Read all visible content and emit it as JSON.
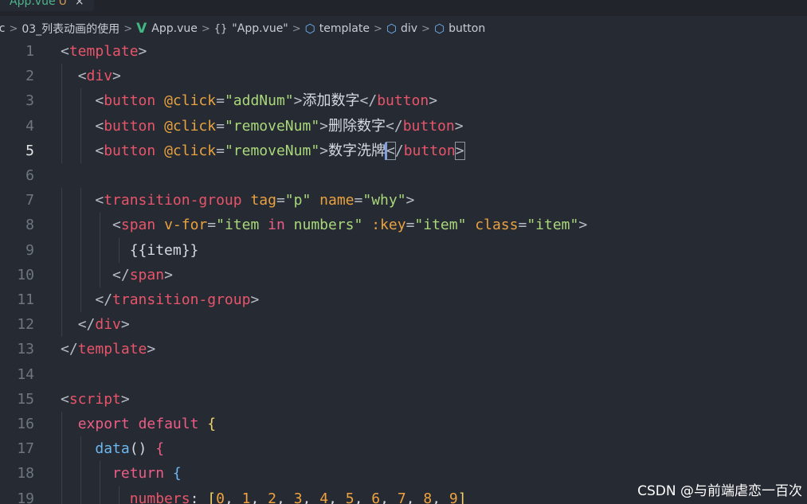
{
  "tab": {
    "filename": "App.vue",
    "modified_mark": "U",
    "close_glyph": "×"
  },
  "breadcrumb": {
    "items": [
      "src",
      "03_列表动画的使用",
      "App.vue",
      "\"App.vue\"",
      "template",
      "div",
      "button"
    ],
    "separator": ">",
    "braces_glyph": "{}",
    "vue_glyph": "V",
    "cube_glyph": "⬡"
  },
  "editor": {
    "active_line": "5",
    "lines": [
      {
        "n": "1",
        "tokens": [
          [
            "<",
            "br"
          ],
          [
            "template",
            "tag"
          ],
          [
            ">",
            "br"
          ]
        ]
      },
      {
        "n": "2",
        "tokens": [
          [
            "  ",
            "pl"
          ],
          [
            "<",
            "br"
          ],
          [
            "div",
            "tag"
          ],
          [
            ">",
            "br"
          ]
        ]
      },
      {
        "n": "3",
        "tokens": [
          [
            "    ",
            "pl"
          ],
          [
            "<",
            "br"
          ],
          [
            "button",
            "tag"
          ],
          [
            " ",
            "pl"
          ],
          [
            "@click",
            "attr"
          ],
          [
            "=",
            "eq"
          ],
          [
            "\"addNum\"",
            "str"
          ],
          [
            ">",
            "br"
          ],
          [
            "添加数字",
            "txt"
          ],
          [
            "</",
            "br"
          ],
          [
            "button",
            "tag"
          ],
          [
            ">",
            "br"
          ]
        ]
      },
      {
        "n": "4",
        "tokens": [
          [
            "    ",
            "pl"
          ],
          [
            "<",
            "br"
          ],
          [
            "button",
            "tag"
          ],
          [
            " ",
            "pl"
          ],
          [
            "@click",
            "attr"
          ],
          [
            "=",
            "eq"
          ],
          [
            "\"removeNum\"",
            "str"
          ],
          [
            ">",
            "br"
          ],
          [
            "删除数字",
            "txt"
          ],
          [
            "</",
            "br"
          ],
          [
            "button",
            "tag"
          ],
          [
            ">",
            "br"
          ]
        ]
      },
      {
        "n": "5",
        "tokens": [
          [
            "    ",
            "pl"
          ],
          [
            "<",
            "br"
          ],
          [
            "button",
            "tag"
          ],
          [
            " ",
            "pl"
          ],
          [
            "@click",
            "attr"
          ],
          [
            "=",
            "eq"
          ],
          [
            "\"removeNum\"",
            "str"
          ],
          [
            ">",
            "br"
          ],
          [
            "数字洗牌",
            "txt"
          ],
          [
            "<",
            "brbox"
          ],
          [
            "/",
            "br"
          ],
          [
            "button",
            "tag"
          ],
          [
            ">",
            "brbox"
          ]
        ]
      },
      {
        "n": "6",
        "tokens": []
      },
      {
        "n": "7",
        "tokens": [
          [
            "    ",
            "pl"
          ],
          [
            "<",
            "br"
          ],
          [
            "transition-group",
            "tag"
          ],
          [
            " ",
            "pl"
          ],
          [
            "tag",
            "attr"
          ],
          [
            "=",
            "eq"
          ],
          [
            "\"p\"",
            "str"
          ],
          [
            " ",
            "pl"
          ],
          [
            "name",
            "attr"
          ],
          [
            "=",
            "eq"
          ],
          [
            "\"why\"",
            "str"
          ],
          [
            ">",
            "br"
          ]
        ]
      },
      {
        "n": "8",
        "tokens": [
          [
            "      ",
            "pl"
          ],
          [
            "<",
            "br"
          ],
          [
            "span",
            "tag"
          ],
          [
            " ",
            "pl"
          ],
          [
            "v-for",
            "attr"
          ],
          [
            "=",
            "eq"
          ],
          [
            "\"item ",
            "str"
          ],
          [
            "in",
            "kw"
          ],
          [
            " numbers\"",
            "str"
          ],
          [
            " ",
            "pl"
          ],
          [
            ":key",
            "attr"
          ],
          [
            "=",
            "eq"
          ],
          [
            "\"item\"",
            "str"
          ],
          [
            " ",
            "pl"
          ],
          [
            "class",
            "attr"
          ],
          [
            "=",
            "eq"
          ],
          [
            "\"item\"",
            "str"
          ],
          [
            ">",
            "br"
          ]
        ]
      },
      {
        "n": "9",
        "tokens": [
          [
            "        ",
            "pl"
          ],
          [
            "{{item}}",
            "txt"
          ]
        ]
      },
      {
        "n": "10",
        "tokens": [
          [
            "      ",
            "pl"
          ],
          [
            "</",
            "br"
          ],
          [
            "span",
            "tag"
          ],
          [
            ">",
            "br"
          ]
        ]
      },
      {
        "n": "11",
        "tokens": [
          [
            "    ",
            "pl"
          ],
          [
            "</",
            "br"
          ],
          [
            "transition-group",
            "tag"
          ],
          [
            ">",
            "br"
          ]
        ]
      },
      {
        "n": "12",
        "tokens": [
          [
            "  ",
            "pl"
          ],
          [
            "</",
            "br"
          ],
          [
            "div",
            "tag"
          ],
          [
            ">",
            "br"
          ]
        ]
      },
      {
        "n": "13",
        "tokens": [
          [
            "</",
            "br"
          ],
          [
            "template",
            "tag"
          ],
          [
            ">",
            "br"
          ]
        ]
      },
      {
        "n": "14",
        "tokens": []
      },
      {
        "n": "15",
        "tokens": [
          [
            "<",
            "br"
          ],
          [
            "script",
            "tag"
          ],
          [
            ">",
            "br"
          ]
        ]
      },
      {
        "n": "16",
        "tokens": [
          [
            "  ",
            "pl"
          ],
          [
            "export",
            "kw"
          ],
          [
            " ",
            "pl"
          ],
          [
            "default",
            "kw"
          ],
          [
            " ",
            "pl"
          ],
          [
            "{",
            "y"
          ]
        ]
      },
      {
        "n": "17",
        "tokens": [
          [
            "    ",
            "pl"
          ],
          [
            "data",
            "fn"
          ],
          [
            "()",
            "pl"
          ],
          [
            " ",
            "pl"
          ],
          [
            "{",
            "kw"
          ]
        ]
      },
      {
        "n": "18",
        "tokens": [
          [
            "      ",
            "pl"
          ],
          [
            "return",
            "kw"
          ],
          [
            " ",
            "pl"
          ],
          [
            "{",
            "fn"
          ]
        ]
      },
      {
        "n": "19",
        "tokens": [
          [
            "        ",
            "pl"
          ],
          [
            "numbers",
            "var"
          ],
          [
            ": ",
            "pl"
          ],
          [
            "[",
            "y"
          ],
          [
            "0",
            "num"
          ],
          [
            ", ",
            "pl"
          ],
          [
            "1",
            "num"
          ],
          [
            ", ",
            "pl"
          ],
          [
            "2",
            "num"
          ],
          [
            ", ",
            "pl"
          ],
          [
            "3",
            "num"
          ],
          [
            ", ",
            "pl"
          ],
          [
            "4",
            "num"
          ],
          [
            ", ",
            "pl"
          ],
          [
            "5",
            "num"
          ],
          [
            ", ",
            "pl"
          ],
          [
            "6",
            "num"
          ],
          [
            ", ",
            "pl"
          ],
          [
            "7",
            "num"
          ],
          [
            ", ",
            "pl"
          ],
          [
            "8",
            "num"
          ],
          [
            ", ",
            "pl"
          ],
          [
            "9",
            "num"
          ],
          [
            "]",
            "y"
          ]
        ]
      }
    ]
  },
  "watermark": "CSDN @与前端虐恋一百次"
}
